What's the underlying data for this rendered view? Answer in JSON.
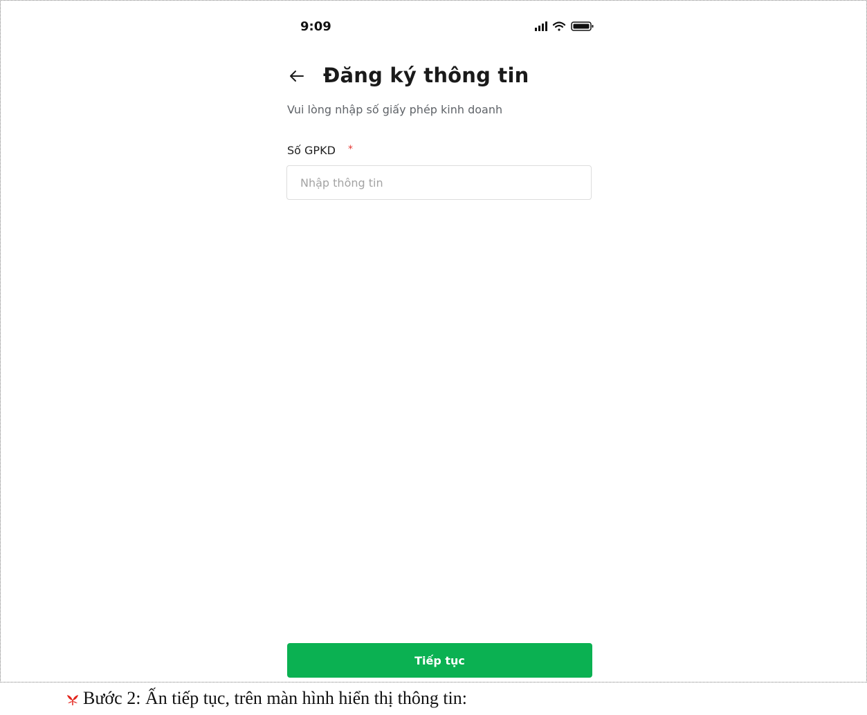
{
  "status_bar": {
    "time": "9:09",
    "icons": [
      "signal-icon",
      "wifi-icon",
      "battery-icon"
    ]
  },
  "header": {
    "back_icon": "arrow-left-icon",
    "title": "Đăng ký thông tin"
  },
  "form": {
    "subtitle": "Vui lòng nhập số giấy phép kinh doanh",
    "field_label": "Số GPKD",
    "required_mark": "*",
    "input_placeholder": "Nhập thông tin",
    "input_value": ""
  },
  "actions": {
    "continue_label": "Tiếp tục"
  },
  "caption": {
    "bullet_icon": "red-leaf-bullet-icon",
    "text": "Bước 2: Ấn tiếp tục, trên màn hình hiển thị thông tin:"
  },
  "colors": {
    "primary_green": "#0bb152",
    "required_red": "#e53935",
    "subtitle_gray": "#5f6368",
    "placeholder_gray": "#a3a3a3",
    "border_gray": "#dcdcdc",
    "bullet_red": "#e2231a"
  }
}
